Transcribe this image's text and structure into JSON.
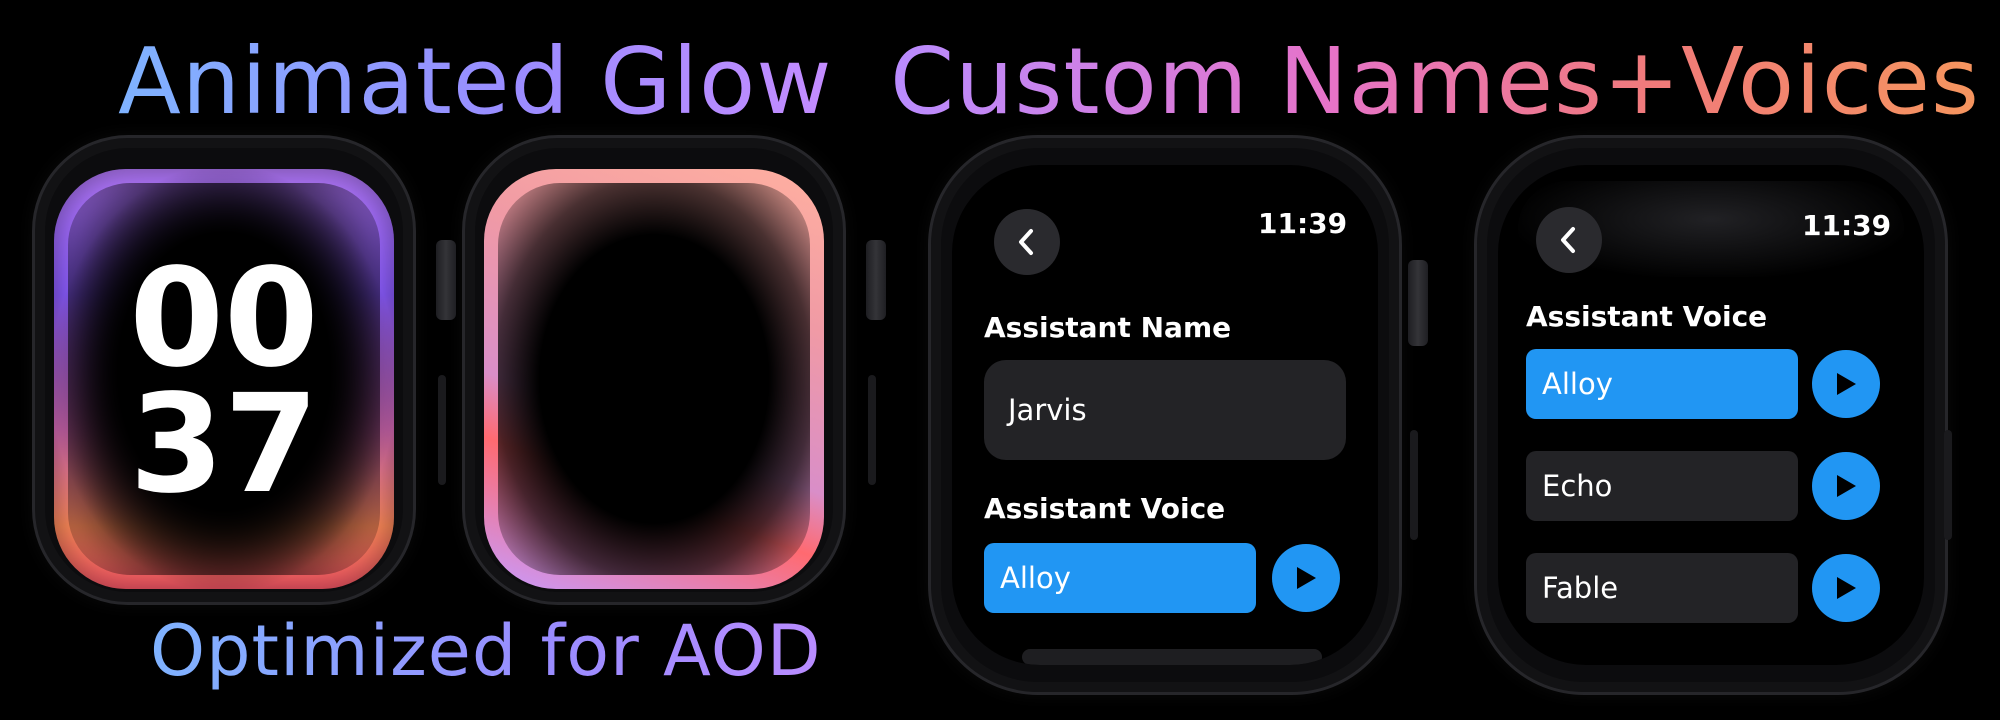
{
  "headlines": {
    "animated_glow": "Animated Glow",
    "custom_names_voices": "Custom Names+Voices",
    "optimized_aod": "Optimized for AOD"
  },
  "watch_glow": {
    "hours": "00",
    "minutes": "37",
    "glow_colors": [
      "#b77bff",
      "#8b5cff",
      "#ff8a5a",
      "#ff5a6a"
    ]
  },
  "watch_aod": {
    "glow_colors": [
      "#ffb0a0",
      "#d98ec8",
      "#ff6a70",
      "#c79bff"
    ]
  },
  "watch_name": {
    "time": "11:39",
    "back_icon": "chevron-left-icon",
    "name_label": "Assistant Name",
    "name_value": "Jarvis",
    "voice_label": "Assistant Voice",
    "voice_selected": "Alloy",
    "play_icon": "play-icon"
  },
  "watch_voices": {
    "time": "11:39",
    "back_icon": "chevron-left-icon",
    "voice_label": "Assistant Voice",
    "options": [
      {
        "label": "Alloy",
        "selected": true
      },
      {
        "label": "Echo",
        "selected": false
      },
      {
        "label": "Fable",
        "selected": false
      }
    ]
  },
  "colors": {
    "accent": "#2196f3",
    "field_bg": "#232326",
    "background": "#000000"
  }
}
